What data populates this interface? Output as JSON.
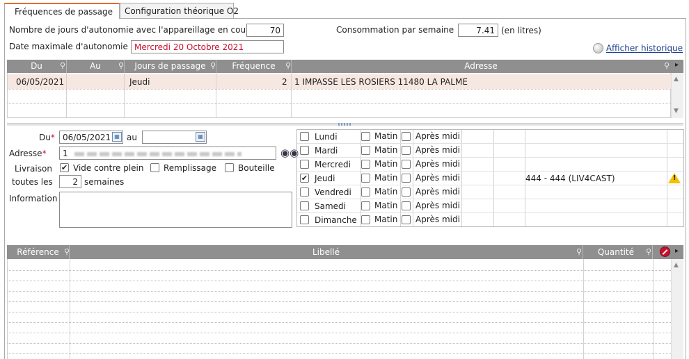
{
  "tabs": [
    {
      "label": "Fréquences de passage",
      "active": true
    },
    {
      "label": "Configuration théorique O2",
      "active": false
    }
  ],
  "autonomy": {
    "days_label": "Nombre de jours d'autonomie avec l'appareillage en cours",
    "days_value": "70",
    "max_date_label": "Date maximale d'autonomie",
    "max_date_value": "Mercredi 20 Octobre 2021",
    "consumption_label": "Consommation par semaine",
    "consumption_value": "7.41",
    "consumption_unit": "(en litres)",
    "history_link": "Afficher historique"
  },
  "schedule_grid": {
    "columns": [
      "Du",
      "Au",
      "Jours de passage",
      "Fréquence",
      "Adresse"
    ],
    "rows": [
      {
        "du": "06/05/2021",
        "au": "",
        "jours": "Jeudi",
        "frequence": "2",
        "adresse": "1 IMPASSE LES ROSIERS 11480 LA PALME"
      }
    ]
  },
  "form": {
    "du_label": "Du",
    "du_value": "06/05/2021",
    "au_label": "au",
    "au_value": "",
    "adresse_label": "Adresse",
    "adresse_value": "1",
    "livraison_label": "Livraison",
    "options": [
      {
        "label": "Vide contre plein",
        "checked": true
      },
      {
        "label": "Remplissage",
        "checked": false
      },
      {
        "label": "Bouteille",
        "checked": false
      }
    ],
    "toutes_les_label": "toutes les",
    "toutes_les_value": "2",
    "semaines_label": "semaines",
    "information_label": "Information",
    "required_mark": "*"
  },
  "days": [
    {
      "name": "Lundi",
      "checked": false,
      "matin": "Matin",
      "apres_midi": "Après midi",
      "info": "",
      "warning": false
    },
    {
      "name": "Mardi",
      "checked": false,
      "matin": "Matin",
      "apres_midi": "Après midi",
      "info": "",
      "warning": false
    },
    {
      "name": "Mercredi",
      "checked": false,
      "matin": "Matin",
      "apres_midi": "Après midi",
      "info": "",
      "warning": false
    },
    {
      "name": "Jeudi",
      "checked": true,
      "matin": "Matin",
      "apres_midi": "Après midi",
      "info": "444 - 444 (LIV4CAST)",
      "warning": true
    },
    {
      "name": "Vendredi",
      "checked": false,
      "matin": "Matin",
      "apres_midi": "Après midi",
      "info": "",
      "warning": false
    },
    {
      "name": "Samedi",
      "checked": false,
      "matin": "Matin",
      "apres_midi": "Après midi",
      "info": "",
      "warning": false
    },
    {
      "name": "Dimanche",
      "checked": false,
      "matin": "Matin",
      "apres_midi": "Après midi",
      "info": "",
      "warning": false
    }
  ],
  "products_grid": {
    "columns": [
      "Référence",
      "Libellé",
      "Quantité"
    ]
  },
  "colors": {
    "accent_tab": "#e36c2a",
    "grid_header": "#8f8f8f",
    "selected_row": "#f7e7e1",
    "required": "#c8102e",
    "link": "#1a3a8a"
  }
}
